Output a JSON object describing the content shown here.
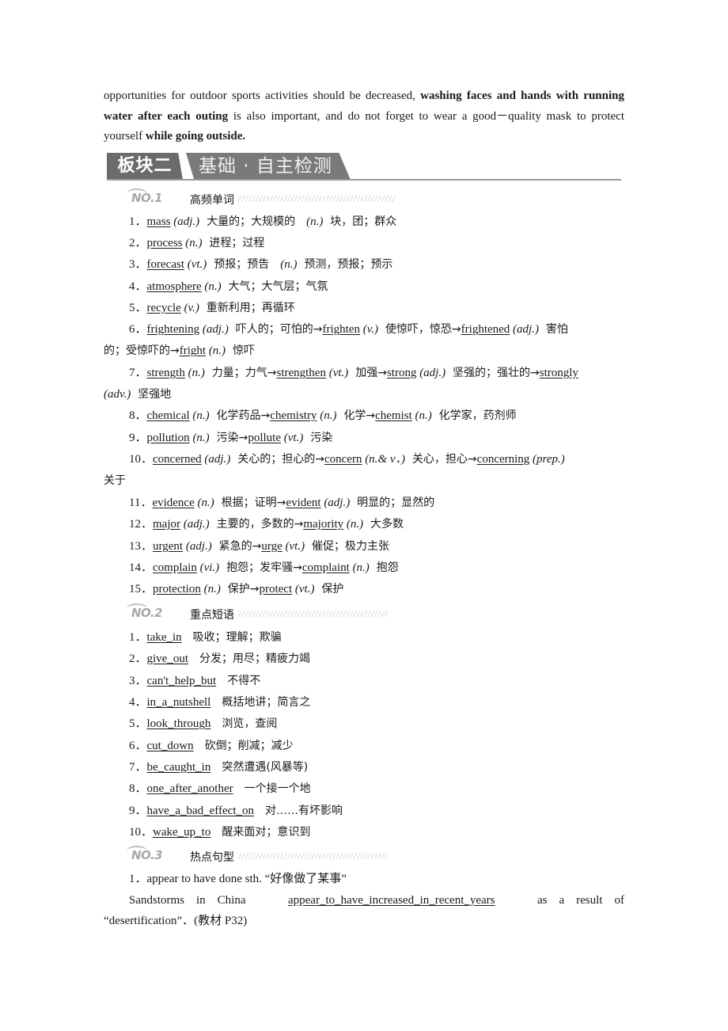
{
  "intro": {
    "seg1": "opportunities for outdoor sports activities should be decreased, ",
    "seg2_bold": "washing faces and hands with running water after each outing",
    "seg3": " is also important, and do not forget to wear a good－quality mask to protect yourself ",
    "seg4_bold": "while going outside."
  },
  "banner": {
    "block": "板块二",
    "title": "基础 · 自主检测"
  },
  "sections": [
    {
      "no": "NO.1",
      "title": "高频单词"
    },
    {
      "no": "NO.2",
      "title": "重点短语"
    },
    {
      "no": "NO.3",
      "title": "热点句型"
    }
  ],
  "words": [
    {
      "n": "1．",
      "parts": [
        [
          "u",
          "mass"
        ],
        [
          "t",
          " "
        ],
        [
          "i",
          "(adj.)"
        ],
        [
          "c",
          "  大量的；大规模的　"
        ],
        [
          "i",
          "(n.)"
        ],
        [
          "c",
          "  块，团；群众"
        ]
      ]
    },
    {
      "n": "2．",
      "parts": [
        [
          "u",
          "process"
        ],
        [
          "t",
          " "
        ],
        [
          "i",
          "(n.)"
        ],
        [
          "c",
          "  进程；过程"
        ]
      ]
    },
    {
      "n": "3．",
      "parts": [
        [
          "u",
          "forecast"
        ],
        [
          "t",
          " "
        ],
        [
          "i",
          "(vt.)"
        ],
        [
          "c",
          "  预报；预告　"
        ],
        [
          "i",
          "(n.)"
        ],
        [
          "c",
          "  预测，预报；预示"
        ]
      ]
    },
    {
      "n": "4．",
      "parts": [
        [
          "u",
          "atmosphere"
        ],
        [
          "t",
          " "
        ],
        [
          "i",
          "(n.)"
        ],
        [
          "c",
          "  大气；大气层；气氛"
        ]
      ]
    },
    {
      "n": "5．",
      "parts": [
        [
          "u",
          "recycle"
        ],
        [
          "t",
          " "
        ],
        [
          "i",
          "(v.)"
        ],
        [
          "c",
          "  重新利用；再循环"
        ]
      ]
    },
    {
      "n": "6．",
      "parts": [
        [
          "u",
          "frightening"
        ],
        [
          "t",
          " "
        ],
        [
          "i",
          "(adj.)"
        ],
        [
          "c",
          "  吓人的；可怕的→"
        ],
        [
          "u",
          "frighten"
        ],
        [
          "t",
          " "
        ],
        [
          "i",
          "(v.)"
        ],
        [
          "c",
          "  使惊吓，惊恐→"
        ],
        [
          "u",
          "frightened"
        ],
        [
          "t",
          " "
        ],
        [
          "i",
          "(adj.)"
        ],
        [
          "c",
          "  害怕"
        ]
      ],
      "cont": [
        [
          "c",
          "的；受惊吓的→"
        ],
        [
          "u",
          "fright"
        ],
        [
          "t",
          " "
        ],
        [
          "i",
          "(n.)"
        ],
        [
          "c",
          "  惊吓"
        ]
      ]
    },
    {
      "n": "7．",
      "parts": [
        [
          "u",
          "strength"
        ],
        [
          "t",
          " "
        ],
        [
          "i",
          "(n.)"
        ],
        [
          "c",
          "  力量；力气→"
        ],
        [
          "u",
          "strengthen"
        ],
        [
          "t",
          " "
        ],
        [
          "i",
          "(vt.)"
        ],
        [
          "c",
          "  加强→"
        ],
        [
          "u",
          "strong"
        ],
        [
          "t",
          " "
        ],
        [
          "i",
          "(adj.)"
        ],
        [
          "c",
          "  坚强的；强壮的→"
        ],
        [
          "u",
          "strongly"
        ]
      ],
      "cont": [
        [
          "i",
          "(adv.)"
        ],
        [
          "c",
          "  坚强地"
        ]
      ]
    },
    {
      "n": "8．",
      "parts": [
        [
          "u",
          "chemical"
        ],
        [
          "t",
          " "
        ],
        [
          "i",
          "(n.)"
        ],
        [
          "c",
          "  化学药品→"
        ],
        [
          "u",
          "chemistry"
        ],
        [
          "t",
          " "
        ],
        [
          "i",
          "(n.)"
        ],
        [
          "c",
          "  化学→"
        ],
        [
          "u",
          "chemist"
        ],
        [
          "t",
          " "
        ],
        [
          "i",
          "(n.)"
        ],
        [
          "c",
          "  化学家，药剂师"
        ]
      ]
    },
    {
      "n": "9．",
      "parts": [
        [
          "u",
          "pollution"
        ],
        [
          "t",
          " "
        ],
        [
          "i",
          "(n.)"
        ],
        [
          "c",
          "  污染→"
        ],
        [
          "u",
          "pollute"
        ],
        [
          "t",
          " "
        ],
        [
          "i",
          "(vt.)"
        ],
        [
          "c",
          "  污染"
        ]
      ]
    },
    {
      "n": "10．",
      "parts": [
        [
          "u",
          "concerned"
        ],
        [
          "t",
          " "
        ],
        [
          "i",
          "(adj.)"
        ],
        [
          "c",
          "  关心的；担心的→"
        ],
        [
          "u",
          "concern"
        ],
        [
          "t",
          " "
        ],
        [
          "i",
          "(n.& v．)"
        ],
        [
          "c",
          "  关心，担心→"
        ],
        [
          "u",
          "concerning"
        ],
        [
          "t",
          " "
        ],
        [
          "i",
          "(prep.)"
        ]
      ],
      "cont": [
        [
          "c",
          "关于"
        ]
      ]
    },
    {
      "n": "11．",
      "parts": [
        [
          "u",
          "evidence"
        ],
        [
          "t",
          " "
        ],
        [
          "i",
          "(n.)"
        ],
        [
          "c",
          "  根据；证明→"
        ],
        [
          "u",
          "evident"
        ],
        [
          "t",
          " "
        ],
        [
          "i",
          "(adj.)"
        ],
        [
          "c",
          "  明显的；显然的"
        ]
      ]
    },
    {
      "n": "12．",
      "parts": [
        [
          "u",
          "major"
        ],
        [
          "t",
          " "
        ],
        [
          "i",
          "(adj.)"
        ],
        [
          "c",
          "  主要的，多数的→"
        ],
        [
          "u",
          "majority"
        ],
        [
          "t",
          " "
        ],
        [
          "i",
          "(n.)"
        ],
        [
          "c",
          "  大多数"
        ]
      ]
    },
    {
      "n": "13．",
      "parts": [
        [
          "u",
          "urgent"
        ],
        [
          "t",
          " "
        ],
        [
          "i",
          "(adj.)"
        ],
        [
          "c",
          "  紧急的→"
        ],
        [
          "u",
          "urge"
        ],
        [
          "t",
          " "
        ],
        [
          "i",
          "(vt.)"
        ],
        [
          "c",
          "  催促；极力主张"
        ]
      ]
    },
    {
      "n": "14．",
      "parts": [
        [
          "u",
          "complain"
        ],
        [
          "t",
          " "
        ],
        [
          "i",
          "(vi.)"
        ],
        [
          "c",
          "  抱怨；发牢骚→"
        ],
        [
          "u",
          "complaint"
        ],
        [
          "t",
          " "
        ],
        [
          "i",
          "(n.)"
        ],
        [
          "c",
          "  抱怨"
        ]
      ]
    },
    {
      "n": "15．",
      "parts": [
        [
          "u",
          "protection"
        ],
        [
          "t",
          " "
        ],
        [
          "i",
          "(n.)"
        ],
        [
          "c",
          "  保护→"
        ],
        [
          "u",
          "protect"
        ],
        [
          "t",
          " "
        ],
        [
          "i",
          "(vt.)"
        ],
        [
          "c",
          "  保护"
        ]
      ]
    }
  ],
  "phrases": [
    {
      "n": "1．",
      "en": "take_in",
      "cn": "吸收；理解；欺骗"
    },
    {
      "n": "2．",
      "en": "give_out",
      "cn": "分发；用尽；精疲力竭"
    },
    {
      "n": "3．",
      "en": "can't_help_but",
      "cn": "不得不"
    },
    {
      "n": "4．",
      "en": "in_a_nutshell",
      "cn": "概括地讲；简言之"
    },
    {
      "n": "5．",
      "en": "look_through",
      "cn": "浏览，查阅"
    },
    {
      "n": "6．",
      "en": "cut_down",
      "cn": "砍倒；削减；减少"
    },
    {
      "n": "7．",
      "en": "be_caught_in",
      "cn": "突然遭遇(风暴等)"
    },
    {
      "n": "8．",
      "en": "one_after_another",
      "cn": "一个接一个地"
    },
    {
      "n": "9．",
      "en": "have_a_bad_effect_on",
      "cn": "对……有坏影响"
    },
    {
      "n": "10．",
      "en": "wake_up_to",
      "cn": "醒来面对；意识到"
    }
  ],
  "sentences": {
    "item1": "1．appear to have done sth. “好像做了某事”",
    "ex_start": "Sandstorms　in　China",
    "ex_blank": "appear_to_have_increased_in_recent_years",
    "ex_end": "as　a　result　of",
    "ex_cont": "“desertification”．(教材 P32)"
  }
}
